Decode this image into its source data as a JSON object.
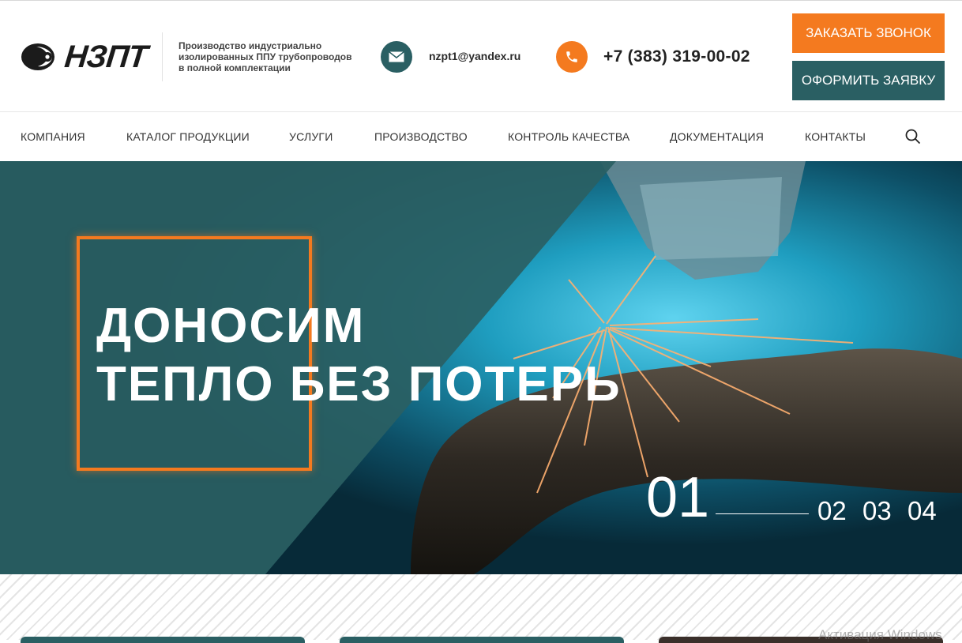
{
  "header": {
    "logo_text": "НЗПТ",
    "tagline": "Производство индустриально изолированных ППУ трубопроводов в полной комплектации",
    "email": "nzpt1@yandex.ru",
    "phone": "+7 (383) 319-00-02",
    "call_button": "ЗАКАЗАТЬ ЗВОНОК",
    "order_button": "ОФОРМИТЬ ЗАЯВКУ"
  },
  "nav": {
    "items": [
      "КОМПАНИЯ",
      "КАТАЛОГ ПРОДУКЦИИ",
      "УСЛУГИ",
      "ПРОИЗВОДСТВО",
      "КОНТРОЛЬ КАЧЕСТВА",
      "ДОКУМЕНТАЦИЯ",
      "КОНТАКТЫ"
    ]
  },
  "hero": {
    "title_line1": "ДОНОСИМ",
    "title_line2": "ТЕПЛО БЕЗ ПОТЕРЬ",
    "current_slide": "01",
    "slides": [
      "02",
      "03",
      "04"
    ]
  },
  "watermark": "Активация Windows",
  "colors": {
    "accent_orange": "#f47a1f",
    "brand_teal": "#2a5f63"
  },
  "icons": {
    "mail": "mail-icon",
    "phone": "phone-icon",
    "search": "search-icon"
  }
}
